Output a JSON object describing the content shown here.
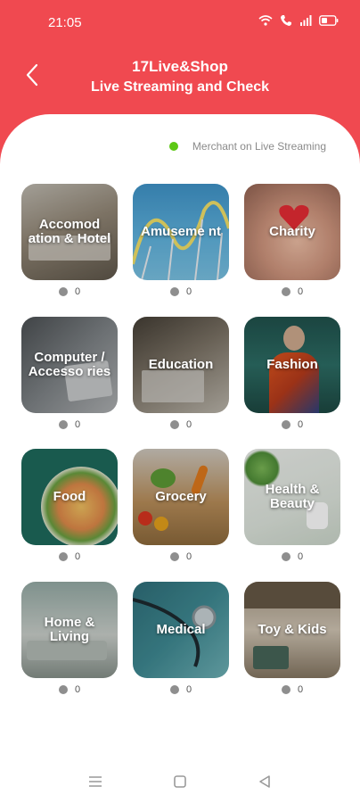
{
  "status_bar": {
    "time": "21:05",
    "icons": [
      "wifi-icon",
      "call-icon",
      "signal-icon",
      "battery-icon"
    ]
  },
  "header": {
    "title": "17Live&Shop",
    "subtitle": "Live Streaming and Check",
    "back_icon": "chevron-left-icon"
  },
  "legend": {
    "text": "Merchant on Live Streaming",
    "color": "#5cc814"
  },
  "categories": [
    {
      "label": "Accomod ation & Hotel",
      "count": "0"
    },
    {
      "label": "Amuseme nt",
      "count": "0"
    },
    {
      "label": "Charity",
      "count": "0"
    },
    {
      "label": "Computer / Accesso ries",
      "count": "0"
    },
    {
      "label": "Education",
      "count": "0"
    },
    {
      "label": "Fashion",
      "count": "0"
    },
    {
      "label": "Food",
      "count": "0"
    },
    {
      "label": "Grocery",
      "count": "0"
    },
    {
      "label": "Health & Beauty",
      "count": "0"
    },
    {
      "label": "Home & Living",
      "count": "0"
    },
    {
      "label": "Medical",
      "count": "0"
    },
    {
      "label": "Toy & Kids",
      "count": "0"
    }
  ],
  "nav_bar": {
    "items": [
      "menu-icon",
      "home-square-icon",
      "back-triangle-icon"
    ]
  },
  "colors": {
    "brand": "#f04950",
    "status_dot_offline": "#8e8e8e"
  }
}
